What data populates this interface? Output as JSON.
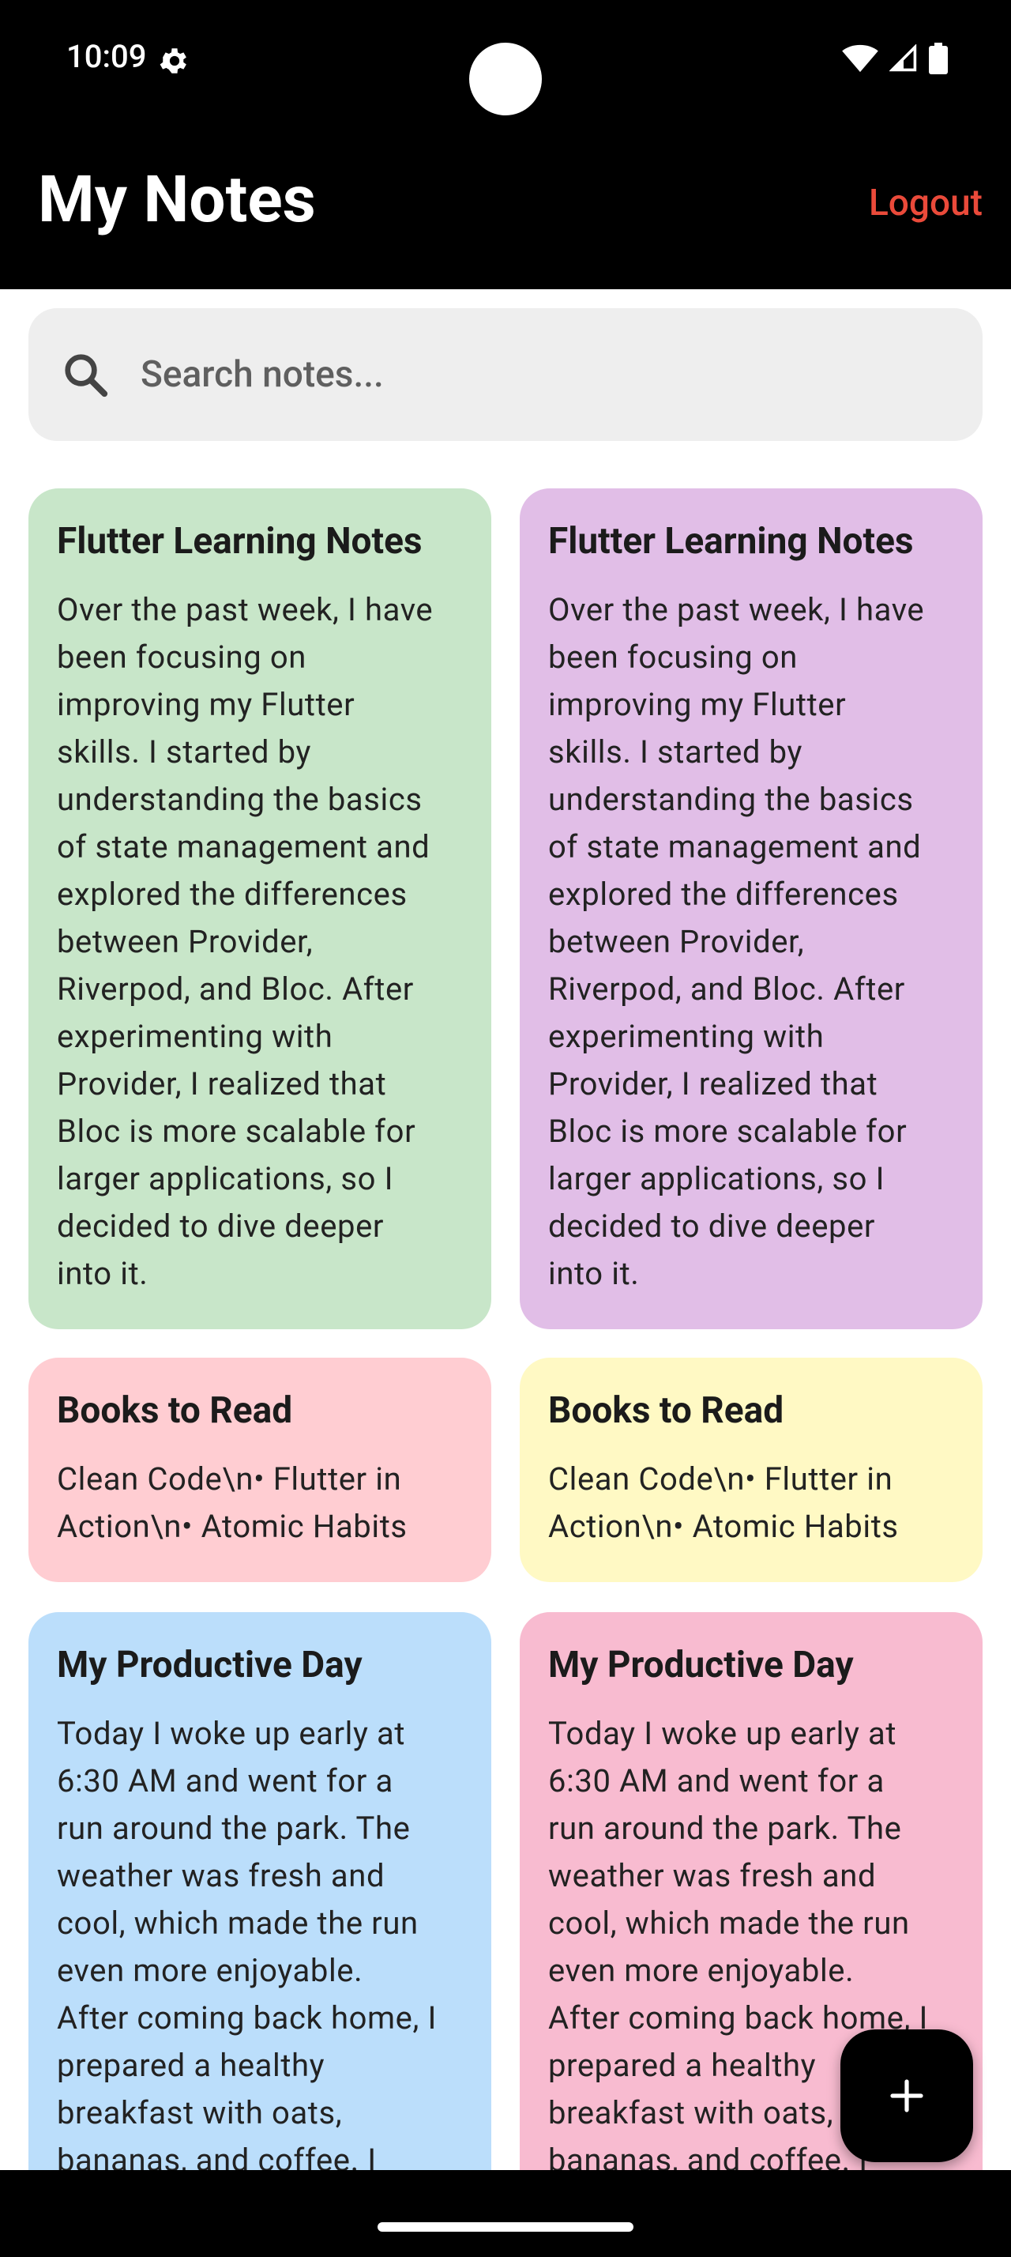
{
  "status_bar": {
    "time": "10:09",
    "icons": [
      "gear-icon",
      "wifi-icon",
      "signal-icon",
      "battery-icon"
    ]
  },
  "app_bar": {
    "title": "My Notes",
    "logout_label": "Logout",
    "logout_color": "#ea4a3a"
  },
  "search": {
    "placeholder": "Search notes...",
    "value": ""
  },
  "notes": [
    {
      "title": "Flutter Learning Notes",
      "body": "Over the past week, I have\nbeen focusing on\nimproving my Flutter\nskills. I started by\nunderstanding the basics\nof state management and\nexplored the differences\nbetween Provider,\nRiverpod, and Bloc. After\nexperimenting with\nProvider, I realized that\nBloc is more scalable for\nlarger applications, so I\ndecided to dive deeper\ninto it.",
      "color": "#c8e6c9"
    },
    {
      "title": "Flutter Learning Notes",
      "body": "Over the past week, I have\nbeen focusing on\nimproving my Flutter\nskills. I started by\nunderstanding the basics\nof state management and\nexplored the differences\nbetween Provider,\nRiverpod, and Bloc. After\nexperimenting with\nProvider, I realized that\nBloc is more scalable for\nlarger applications, so I\ndecided to dive deeper\ninto it.",
      "color": "#e1bee7"
    },
    {
      "title": "Books to Read",
      "body": "Clean Code\\n• Flutter in\nAction\\n• Atomic Habits",
      "color": "#ffcdd2"
    },
    {
      "title": "Books to Read",
      "body": "Clean Code\\n• Flutter in\nAction\\n• Atomic Habits",
      "color": "#fff9c4"
    },
    {
      "title": "My Productive Day",
      "body": "Today I woke up early at\n6:30 AM and went for a\nrun around the park. The\nweather was fresh and\ncool, which made the run\neven more enjoyable.\nAfter coming back home, I\nprepared a healthy\nbreakfast with oats,\nbananas, and coffee. I",
      "color": "#bbdefb"
    },
    {
      "title": "My Productive Day",
      "body": "Today I woke up early at\n6:30 AM and went for a\nrun around the park. The\nweather was fresh and\ncool, which made the run\neven more enjoyable.\nAfter coming back home, I\nprepared a healthy\nbreakfast with oats,\nbananas, and coffee. I",
      "color": "#f8bbd0"
    }
  ],
  "fab": {
    "icon": "plus-icon"
  }
}
